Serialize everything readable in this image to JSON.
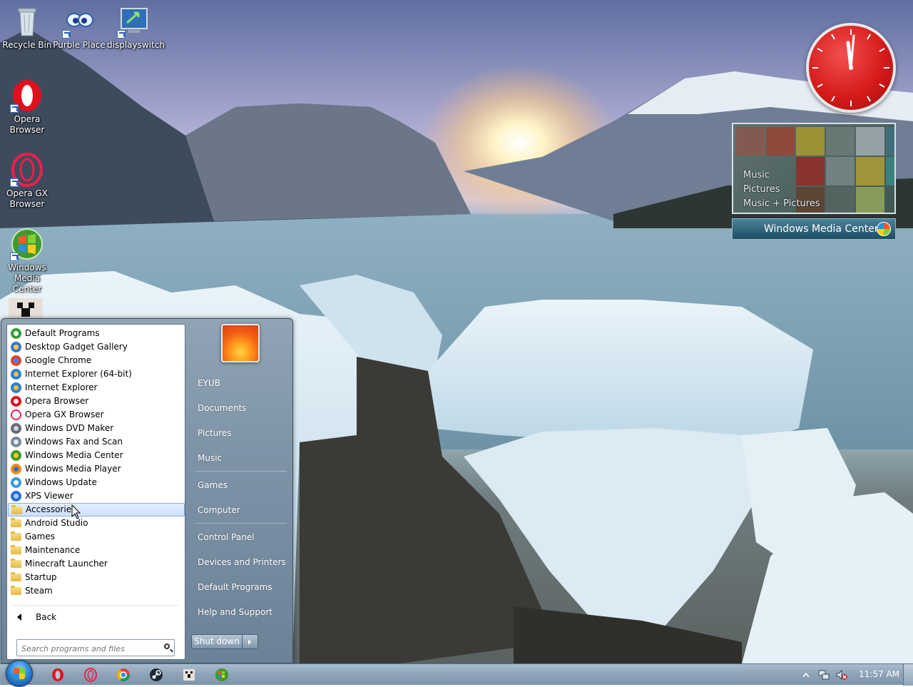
{
  "desktop": {
    "icons": [
      {
        "label": "Recycle Bin",
        "icon": "recycle-bin-icon"
      },
      {
        "label": "Purble Place",
        "icon": "purble-place-icon"
      },
      {
        "label": "displayswitch",
        "icon": "display-switch-icon"
      },
      {
        "label": "Opera Browser",
        "icon": "opera-icon"
      },
      {
        "label": "Opera GX Browser",
        "icon": "opera-gx-icon"
      },
      {
        "label": "Windows Media Center",
        "icon": "windows-media-center-icon"
      }
    ]
  },
  "gadgets": {
    "media_center": {
      "menu": [
        "Music",
        "Pictures",
        "Music + Pictures"
      ],
      "title": "Windows Media Center"
    }
  },
  "start_menu": {
    "programs": [
      {
        "label": "Default Programs",
        "icon": "default-programs-icon"
      },
      {
        "label": "Desktop Gadget Gallery",
        "icon": "gadget-gallery-icon"
      },
      {
        "label": "Google Chrome",
        "icon": "chrome-icon"
      },
      {
        "label": "Internet Explorer (64-bit)",
        "icon": "ie-icon"
      },
      {
        "label": "Internet Explorer",
        "icon": "ie-icon"
      },
      {
        "label": "Opera Browser",
        "icon": "opera-icon"
      },
      {
        "label": "Opera GX Browser",
        "icon": "opera-gx-icon"
      },
      {
        "label": "Windows DVD Maker",
        "icon": "dvd-maker-icon"
      },
      {
        "label": "Windows Fax and Scan",
        "icon": "fax-scan-icon"
      },
      {
        "label": "Windows Media Center",
        "icon": "windows-media-center-icon"
      },
      {
        "label": "Windows Media Player",
        "icon": "media-player-icon"
      },
      {
        "label": "Windows Update",
        "icon": "windows-update-icon"
      },
      {
        "label": "XPS Viewer",
        "icon": "xps-viewer-icon"
      },
      {
        "label": "Accessories",
        "icon": "folder-icon",
        "selected": true
      },
      {
        "label": "Android Studio",
        "icon": "folder-icon"
      },
      {
        "label": "Games",
        "icon": "folder-icon"
      },
      {
        "label": "Maintenance",
        "icon": "folder-icon"
      },
      {
        "label": "Minecraft Launcher",
        "icon": "folder-icon"
      },
      {
        "label": "Startup",
        "icon": "folder-icon"
      },
      {
        "label": "Steam",
        "icon": "folder-icon"
      }
    ],
    "back_label": "Back",
    "search_placeholder": "Search programs and files",
    "right_links": [
      "EYUB",
      "Documents",
      "Pictures",
      "Music",
      "Games",
      "Computer",
      "Control Panel",
      "Devices and Printers",
      "Default Programs",
      "Help and Support"
    ],
    "shutdown_label": "Shut down"
  },
  "taskbar": {
    "pinned": [
      "opera-icon",
      "opera-gx-icon",
      "chrome-icon",
      "steam-icon",
      "minecraft-icon",
      "windows-media-center-icon"
    ],
    "time": "11:57 AM"
  }
}
